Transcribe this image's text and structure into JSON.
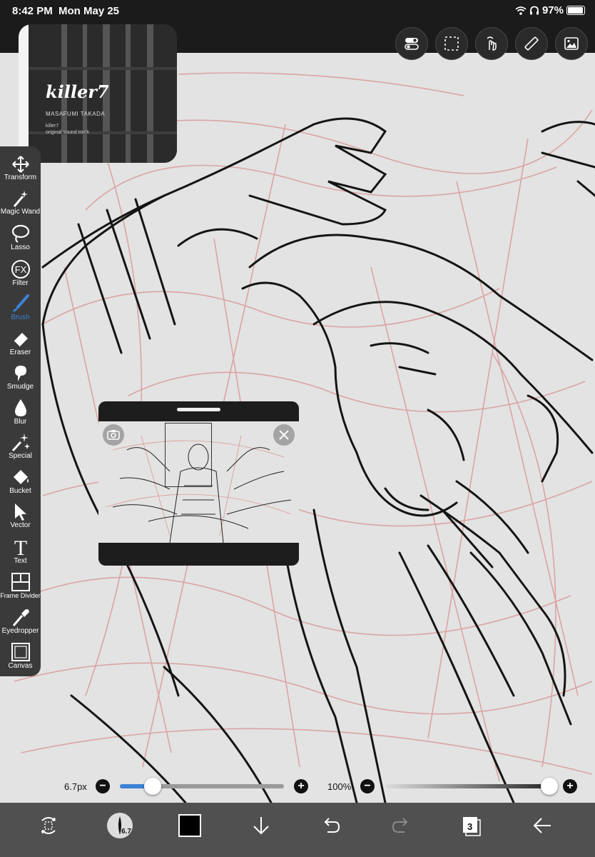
{
  "status_bar": {
    "time": "8:42 PM",
    "date": "Mon May 25",
    "battery": "97%"
  },
  "top_buttons": [
    "layers-toggle-icon",
    "selection-icon",
    "gesture-icon",
    "ruler-icon",
    "gallery-icon"
  ],
  "video_overlay": {
    "title": "killer7",
    "artist": "MASAFUMI TAKADA",
    "line1": "killer7",
    "line2": "original sound track"
  },
  "tools": [
    {
      "label": "Transform",
      "icon": "transform-icon"
    },
    {
      "label": "Magic Wand",
      "icon": "magic-wand-icon"
    },
    {
      "label": "Lasso",
      "icon": "lasso-icon"
    },
    {
      "label": "Filter",
      "icon": "fx-icon"
    },
    {
      "label": "Brush",
      "icon": "brush-icon",
      "active": true
    },
    {
      "label": "Eraser",
      "icon": "eraser-icon"
    },
    {
      "label": "Smudge",
      "icon": "smudge-icon"
    },
    {
      "label": "Blur",
      "icon": "blur-drop-icon"
    },
    {
      "label": "Special",
      "icon": "special-sparkle-icon"
    },
    {
      "label": "Bucket",
      "icon": "bucket-icon"
    },
    {
      "label": "Vector",
      "icon": "vector-arrow-icon"
    },
    {
      "label": "Text",
      "icon": "text-icon"
    },
    {
      "label": "Frame Divider",
      "icon": "frame-divider-icon"
    },
    {
      "label": "Eyedropper",
      "icon": "eyedropper-icon"
    },
    {
      "label": "Canvas",
      "icon": "canvas-icon"
    }
  ],
  "navigator": {
    "label": ""
  },
  "sliders": {
    "brush_size": "6.7px",
    "brush_size_fraction": 0.2,
    "opacity": "100%",
    "opacity_fraction": 1.0
  },
  "bottom_bar": {
    "brush_size_badge": "6.7",
    "layer_count": "3",
    "color": "#000000"
  },
  "colors": {
    "accent": "#3b82d6",
    "sketch_red": "#d99a98",
    "ink": "#111111"
  }
}
